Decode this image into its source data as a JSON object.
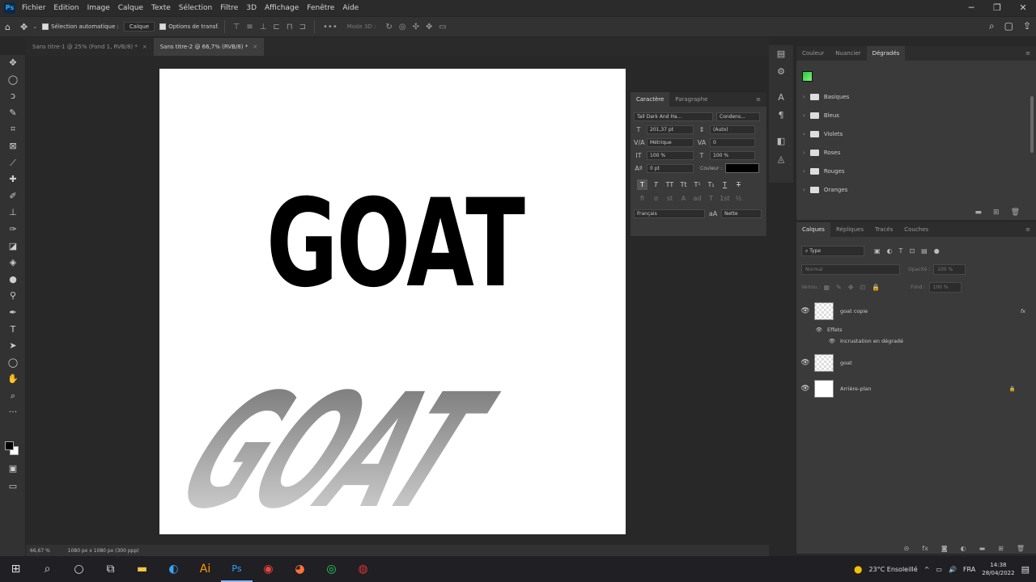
{
  "app": {
    "logo_text": "Ps",
    "menu": [
      "Fichier",
      "Edition",
      "Image",
      "Calque",
      "Texte",
      "Sélection",
      "Filtre",
      "3D",
      "Affichage",
      "Fenêtre",
      "Aide"
    ],
    "window_controls": [
      "─",
      "❐",
      "✕"
    ]
  },
  "options": {
    "auto_select_label": "Sélection automatique :",
    "auto_select_value": "Calque",
    "transform_label": "Options de transf.",
    "mode_3d": "Mode 3D :",
    "more": "•••"
  },
  "tabs": [
    {
      "label": "Sans titre-1 @ 25% (Fond 1, RVB/8) *",
      "active": false
    },
    {
      "label": "Sans titre-2 @ 66,7% (RVB/8) *",
      "active": true
    }
  ],
  "canvas": {
    "main_text": "GOAT",
    "reflection_text": "GOAT",
    "shadow_color_top": "#6e6e6e",
    "shadow_color_bottom": "#dedede"
  },
  "character": {
    "tabs": [
      "Caractère",
      "Paragraphe"
    ],
    "font_family": "Tall Dark And Ha...",
    "font_style": "Condens...",
    "size": "201,37 pt",
    "leading": "(Auto)",
    "kerning": "Métrique",
    "tracking": "0",
    "vscale": "100 %",
    "hscale": "100 %",
    "baseline": "0 pt",
    "color_label": "Couleur :",
    "language": "Français",
    "aa": "Nette",
    "aa_icon": "aA"
  },
  "gradients": {
    "tabs": [
      "Couleur",
      "Nuancier",
      "Dégradés"
    ],
    "folders": [
      "Basiques",
      "Bleus",
      "Violets",
      "Roses",
      "Rouges",
      "Oranges"
    ]
  },
  "layers": {
    "tabs": [
      "Calques",
      "Répliques",
      "Tracés",
      "Couches"
    ],
    "filter_type": "Type",
    "blend_mode": "Normal",
    "opacity_label": "Opacité :",
    "opacity_value": "100 %",
    "lock_label": "Verrou :",
    "fill_label": "Fond :",
    "fill_value": "100 %",
    "items": [
      {
        "name": "goat copie",
        "fx": "fx"
      },
      {
        "name": "Effets"
      },
      {
        "name": "Incrustation en dégradé"
      },
      {
        "name": "goat"
      },
      {
        "name": "Arrière-plan"
      }
    ]
  },
  "status": {
    "zoom": "66,67 %",
    "doc_size": "1080 px x 1080 px (300 ppp)"
  },
  "taskbar": {
    "weather": "23°C  Ensoleillé",
    "lang": "FRA",
    "time": "14:38",
    "date": "28/04/2022"
  }
}
